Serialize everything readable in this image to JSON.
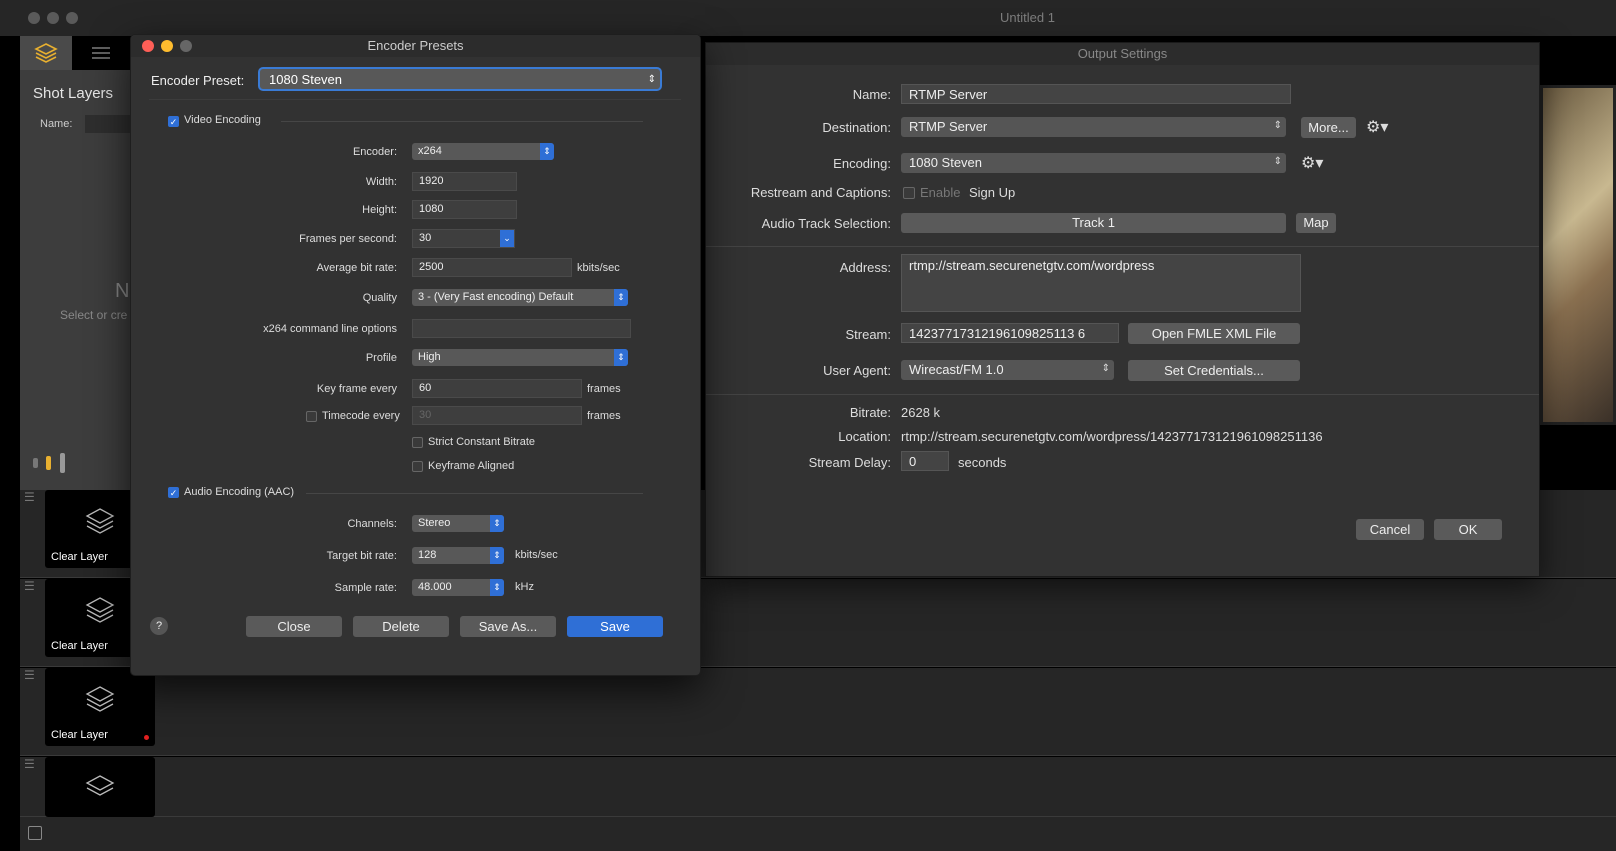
{
  "main": {
    "title": "Untitled 1",
    "shot_layers_title": "Shot Layers",
    "name_label": "Name:",
    "placeholder_letter": "N",
    "placeholder_text": "Select or cre",
    "layers": [
      {
        "label": "Clear Layer"
      },
      {
        "label": "Clear Layer"
      },
      {
        "label": "Clear Layer"
      }
    ]
  },
  "output_settings": {
    "title": "Output Settings",
    "name_label": "Name:",
    "name_value": "RTMP Server",
    "destination_label": "Destination:",
    "destination_value": "RTMP Server",
    "more_button": "More...",
    "encoding_label": "Encoding:",
    "encoding_value": "1080 Steven",
    "restream_label": "Restream and Captions:",
    "enable_label": "Enable",
    "signup_label": "Sign Up",
    "audio_track_label": "Audio Track Selection:",
    "audio_track_value": "Track 1",
    "map_button": "Map",
    "address_label": "Address:",
    "address_value": "rtmp://stream.securenetgtv.com/wordpress",
    "stream_label": "Stream:",
    "stream_value": "14237717312196109825113 6",
    "open_fmle_button": "Open FMLE XML File",
    "user_agent_label": "User Agent:",
    "user_agent_value": "Wirecast/FM 1.0",
    "set_credentials_button": "Set Credentials...",
    "bitrate_label": "Bitrate:",
    "bitrate_value": "2628 k",
    "location_label": "Location:",
    "location_value": "rtmp://stream.securenetgtv.com/wordpress/142377173121961098251136",
    "stream_delay_label": "Stream Delay:",
    "stream_delay_value": "0",
    "stream_delay_unit": "seconds",
    "cancel_button": "Cancel",
    "ok_button": "OK"
  },
  "encoder_presets": {
    "title": "Encoder Presets",
    "preset_label": "Encoder Preset:",
    "preset_value": "1080 Steven",
    "video_encoding_label": "Video Encoding",
    "encoder_label": "Encoder:",
    "encoder_value": "x264",
    "width_label": "Width:",
    "width_value": "1920",
    "height_label": "Height:",
    "height_value": "1080",
    "fps_label": "Frames per second:",
    "fps_value": "30",
    "avg_bitrate_label": "Average bit rate:",
    "avg_bitrate_value": "2500",
    "avg_bitrate_unit": "kbits/sec",
    "quality_label": "Quality",
    "quality_value": "3 - (Very Fast encoding) Default",
    "cmdline_label": "x264 command line options",
    "cmdline_value": "",
    "profile_label": "Profile",
    "profile_value": "High",
    "keyframe_label": "Key frame every",
    "keyframe_value": "60",
    "keyframe_unit": "frames",
    "timecode_label": "Timecode every",
    "timecode_value": "30",
    "timecode_unit": "frames",
    "strict_cbr_label": "Strict Constant Bitrate",
    "keyframe_aligned_label": "Keyframe Aligned",
    "audio_encoding_label": "Audio Encoding (AAC)",
    "channels_label": "Channels:",
    "channels_value": "Stereo",
    "target_bitrate_label": "Target bit rate:",
    "target_bitrate_value": "128",
    "target_bitrate_unit": "kbits/sec",
    "sample_rate_label": "Sample rate:",
    "sample_rate_value": "48.000",
    "sample_rate_unit": "kHz",
    "help_button": "?",
    "close_button": "Close",
    "delete_button": "Delete",
    "save_as_button": "Save As...",
    "save_button": "Save",
    "accent_color": "#2f6fd6"
  }
}
